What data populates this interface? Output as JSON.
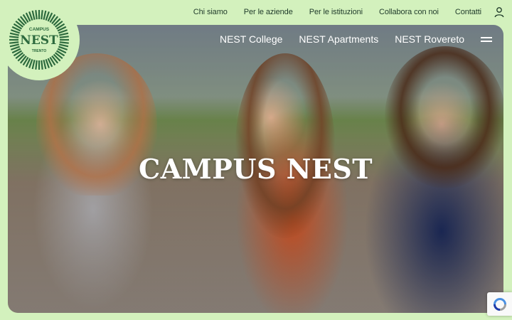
{
  "top_nav": {
    "items": [
      "Chi siamo",
      "Per le aziende",
      "Per le istituzioni",
      "Collabora con noi",
      "Contatti"
    ]
  },
  "hero_nav": {
    "items": [
      "NEST College",
      "NEST Apartments",
      "NEST Rovereto"
    ]
  },
  "hero": {
    "title": "CAMPUS NEST"
  },
  "logo": {
    "top": "CAMPUS",
    "main": "NEST",
    "bottom": "TRENTO"
  },
  "colors": {
    "background": "#d3f1bd",
    "brand_green": "#2d6a3e",
    "nav_text": "#1f3a2a"
  },
  "icons": [
    "user-icon",
    "hamburger-menu-icon",
    "recaptcha-icon"
  ]
}
